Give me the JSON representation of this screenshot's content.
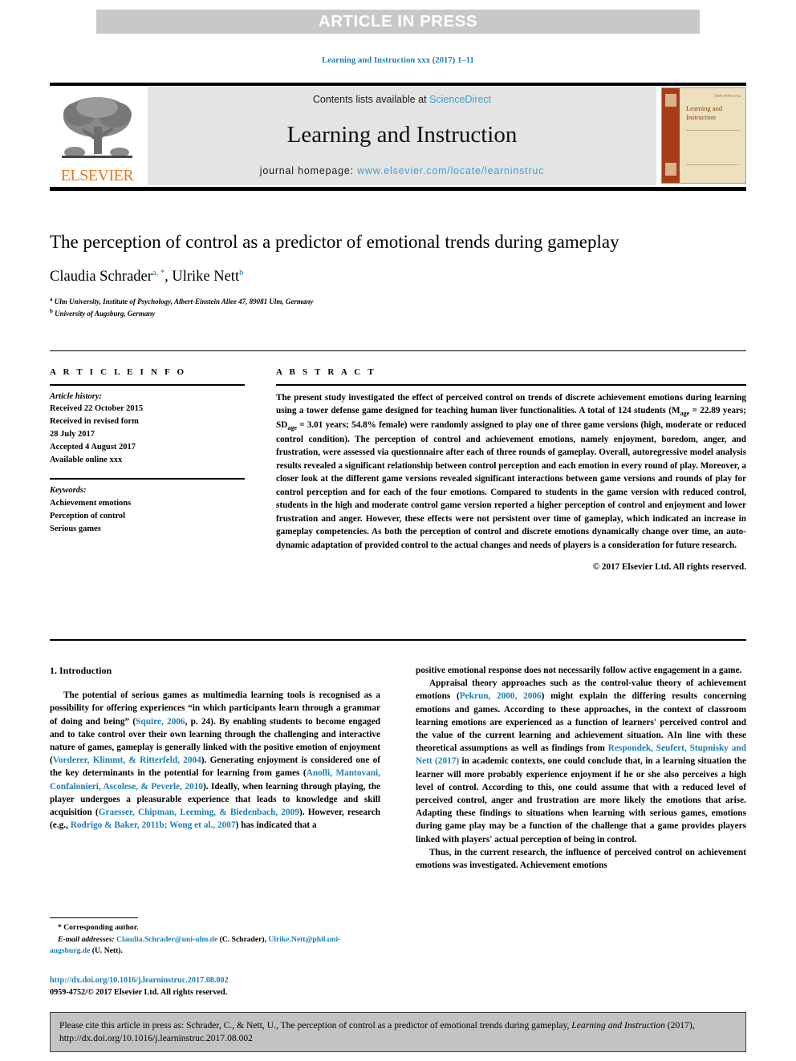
{
  "banner": {
    "label": "ARTICLE IN PRESS",
    "background": "#c8c8c8",
    "text_color": "#ffffff"
  },
  "running_head": "Learning and Instruction xxx (2017) 1–11",
  "masthead": {
    "publisher_logo_text": "ELSEVIER",
    "publisher_logo_color": "#e87722",
    "contents_prefix": "Contents lists available at ",
    "contents_link": "ScienceDirect",
    "journal_name": "Learning and Instruction",
    "homepage_prefix": "journal homepage: ",
    "homepage_link": "www.elsevier.com/locate/learninstruc",
    "link_color": "#3a9fd4",
    "band_background": "#e4e4e4",
    "cover": {
      "title_line1": "Learning and",
      "title_line2": "Instruction",
      "issn_text": "ISSN 0959-4752",
      "spine_color": "#a63d16",
      "paper_color": "#ece0bd",
      "title_color": "#8d3a12"
    }
  },
  "article": {
    "title": "The perception of control as a predictor of emotional trends during gameplay",
    "authors": [
      {
        "name": "Claudia Schrader",
        "markers": "a, *"
      },
      {
        "name": "Ulrike Nett",
        "markers": "b"
      }
    ],
    "authors_display": "Claudia Schrader",
    "author2_display": ", Ulrike Nett",
    "affiliations": [
      {
        "marker": "a",
        "text": "Ulm University, Institute of Psychology, Albert-Einstein Allee 47, 89081 Ulm, Germany"
      },
      {
        "marker": "b",
        "text": "University of Augsburg, Germany"
      }
    ]
  },
  "article_info": {
    "heading": "A R T I C L E   I N F O",
    "history_label": "Article history:",
    "history_lines": [
      "Received 22 October 2015",
      "Received in revised form",
      "28 July 2017",
      "Accepted 4 August 2017",
      "Available online xxx"
    ],
    "keywords_label": "Keywords:",
    "keywords": [
      "Achievement emotions",
      "Perception of control",
      "Serious games"
    ]
  },
  "abstract": {
    "heading": "A B S T R A C T",
    "part1": "The present study investigated the effect of perceived control on trends of discrete achievement emotions during learning using a tower defense game designed for teaching human liver functionalities. A total of 124 students (M",
    "sub1": "age",
    "part2": " = 22.89 years; SD",
    "sub2": "age",
    "part3": " = 3.01 years; 54.8% female) were randomly assigned to play one of three game versions (high, moderate or reduced control condition). The perception of control and achievement emotions, namely enjoyment, boredom, anger, and frustration, were assessed via questionnaire after each of three rounds of gameplay. Overall, autoregressive model analysis results revealed a significant relationship between control perception and each emotion in every round of play. Moreover, a closer look at the different game versions revealed significant interactions between game versions and rounds of play for control perception and for each of the four emotions. Compared to students in the game version with reduced control, students in the high and moderate control game version reported a higher perception of control and enjoyment and lower frustration and anger. However, these effects were not persistent over time of gameplay, which indicated an increase in gameplay competencies. As both the perception of control and discrete emotions dynamically change over time, an auto-dynamic adaptation of provided control to the actual changes and needs of players is a consideration for future research.",
    "copyright": "© 2017 Elsevier Ltd. All rights reserved."
  },
  "body": {
    "section_heading": "1. Introduction",
    "left_p1_a": "The potential of serious games as multimedia learning tools is recognised as a possibility for offering experiences “in which participants learn through a grammar of doing and being” (",
    "left_ref1": "Squire, 2006",
    "left_p1_b": ", p. 24). By enabling students to become engaged and to take control over their own learning through the challenging and interactive nature of games, gameplay is generally linked with the positive emotion of enjoyment (",
    "left_ref2": "Vorderer, Klimmt, & Ritterfeld, 2004",
    "left_p1_c": "). Generating enjoyment is considered one of the key determinants in the potential for learning from games (",
    "left_ref3": "Anolli, Mantovani, Confalonieri, Ascolese, & Peverle, 2010",
    "left_p1_d": "). Ideally, when learning through playing, the player undergoes a pleasurable experience that leads to knowledge and skill acquisition (",
    "left_ref4": "Graesser, Chipman, Leeming, & Biedenbach, 2009",
    "left_p1_e": "). However, research (e.g., ",
    "left_ref5": "Rodrigo & Baker, 2011b; Wong et al., 2007",
    "left_p1_f": ") has indicated that a",
    "right_p1": "positive emotional response does not necessarily follow active engagement in a game.",
    "right_p2_a": "Appraisal theory approaches such as the control-value theory of achievement emotions (",
    "right_ref1": "Pekrun, 2000, 2006",
    "right_p2_b": ") might explain the differing results concerning emotions and games. According to these approaches, in the context of classroom learning emotions are experienced as a function of learners' perceived control and the value of the current learning and achievement situation. AIn line with these theoretical assumptions as well as findings from ",
    "right_ref2": "Respondek, Seufert, Stupnisky and Nett (2017)",
    "right_p2_c": " in academic contexts, one could conclude that, in a learning situation the learner will more probably experience enjoyment if he or she also perceives a high level of control. According to this, one could assume that with a reduced level of perceived control, anger and frustration are more likely the emotions that arise. Adapting these findings to situations when learning with serious games, emotions during game play may be a function of the challenge that a game provides players linked with players' actual perception of being in control.",
    "right_p3": "Thus, in the current research, the influence of perceived control on achievement emotions was investigated. Achievement emotions"
  },
  "footnotes": {
    "corresponding": "* Corresponding author.",
    "email_label": "E-mail addresses:",
    "email1": "Claudia.Schrader@uni-ulm.de",
    "email1_owner": " (C. Schrader), ",
    "email2": "Ulrike.Nett@phil.uni-augsburg.de",
    "email2_owner": " (U. Nett).",
    "doi": "http://dx.doi.org/10.1016/j.learninstruc.2017.08.002",
    "issn_copyright": "0959-4752/© 2017 Elsevier Ltd. All rights reserved."
  },
  "citation_footer": {
    "text_a": "Please cite this article in press as: Schrader, C., & Nett, U., The perception of control as a predictor of emotional trends during gameplay, ",
    "italic_a": "Learning and Instruction",
    "text_b": " (2017), http://dx.doi.org/10.1016/j.learninstruc.2017.08.002",
    "background": "#c3c3c3"
  }
}
